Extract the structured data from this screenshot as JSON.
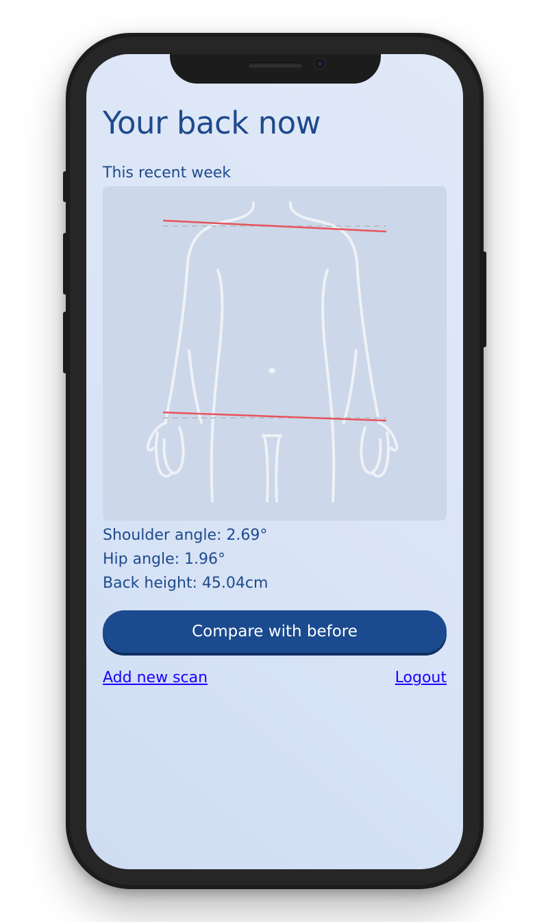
{
  "screen": {
    "title": "Your back now",
    "subtitle": "This recent week"
  },
  "scan": {
    "image": "back-body-outline",
    "line_color": "#e8525a",
    "reference_line_color": "#b7bfc9"
  },
  "metrics": {
    "shoulder_angle": "Shoulder angle: 2.69°",
    "hip_angle": "Hip angle: 1.96°",
    "back_height": "Back height: 45.04cm"
  },
  "actions": {
    "compare_label": "Compare with before",
    "add_scan_label": "Add new scan",
    "logout_label": "Logout"
  },
  "colors": {
    "primary": "#1d4a8c",
    "button": "#1b4a8e",
    "link": "#1a00ff",
    "background": "#d9e4f6"
  }
}
